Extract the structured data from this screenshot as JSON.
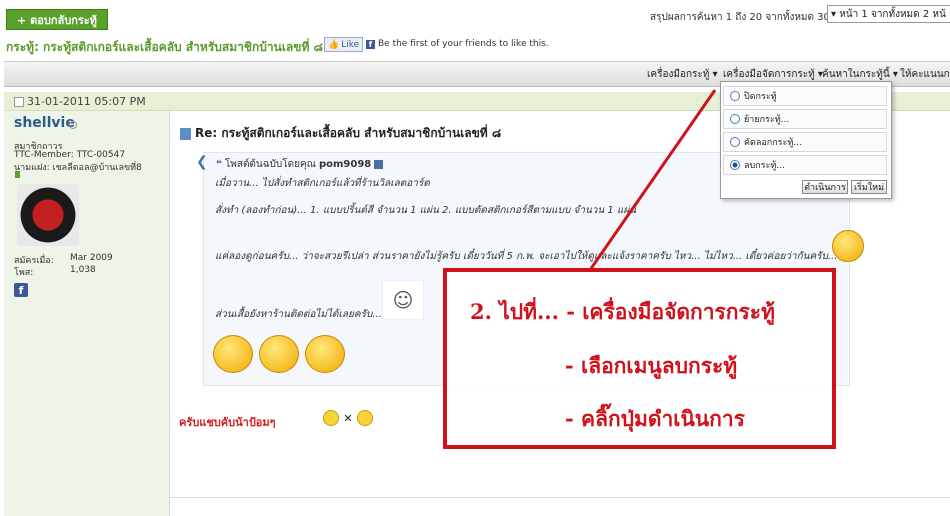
{
  "top": {
    "reply_button": "+ ตอบกลับกระทู้",
    "results_text": "สรุปผลการค้นหา 1 ถึง 20 จากทั้งหมด 30",
    "page_select": "▾ หน้า 1 จากทั้งหมด 2 หน้"
  },
  "thread": {
    "title": "กระทู้: กระทู้สติกเกอร์และเสื้อคลับ สำหรับสมาชิกบ้านเลขที่ ๘",
    "like_label": "Like",
    "fb_text": "Be the first of your friends to like this."
  },
  "toolbar": {
    "items": [
      "เครื่องมือกระทู้ ▾",
      "เครื่องมือจัดการกระทู้ ▾",
      "ค้นหาในกระทู้นี้ ▾",
      "ให้คะแนนกระ"
    ]
  },
  "post": {
    "date": "31-01-2011 05:07 PM",
    "username": "shellvie",
    "rank": "สมาชิกถาวร",
    "member_id": "TTC-Member: TTC-00547",
    "nickname": "นามแฝง: เชลลีดอล@บ้านเลขที่8",
    "join_label": "สมัครเมื่อ:",
    "join_value": "Mar 2009",
    "posts_label": "โพส:",
    "posts_value": "1,038",
    "title": "Re: กระทู้สติกเกอร์และเสื้อคลับ สำหรับสมาชิกบ้านเลขที่ ๘",
    "quote_author_prefix": "โพสต์ต้นฉบับโดยคุณ",
    "quote_author": "pom9098",
    "quote_lines": [
      "เมื่อวาน... ไปสั่งทำสติกเกอร์แล้วที่ร้านวิลเลตอาร์ต",
      "สั่งทำ (ลองทำก่อน)... 1. แบบปริ้นต์สี จำนวน 1 แผ่น 2. แบบตัดสติกเกอร์สีตามแบบ จำนวน 1 แผ่น",
      "แค่ลองดูก่อนครับ... ว่าจะสวยรึเปล่า ส่วนราคายังไม่รู้ครับ เดี๋ยววันที่ 5 ก.พ. จะเอาไปให้ดูและแจ้งราคาครับ ไหว... ไม่ไหว... เดี๋ยวค่อยว่ากันครับ...",
      "ส่วนเสื้อยังหาร้านติดต่อไม่ได้เลยครับ..."
    ],
    "reply_text": "ครับแชบคับน้าป้อมๆ"
  },
  "dropdown": {
    "options": [
      "ปิดกระทู้",
      "ย้ายกระทู้...",
      "คัดลอกกระทู้...",
      "ลบกระทู้..."
    ],
    "selected_index": 3,
    "go_button": "ดำเนินการ",
    "reset_button": "เริ่มใหม่"
  },
  "annotation": {
    "line1": "2. ไปที่... - เครื่องมือจัดการกระทู้",
    "line2": "- เลือกเมนูลบกระทู้",
    "line3": "- คลิ๊กปุ่มดำเนินการ",
    "color": "#d0121c"
  }
}
